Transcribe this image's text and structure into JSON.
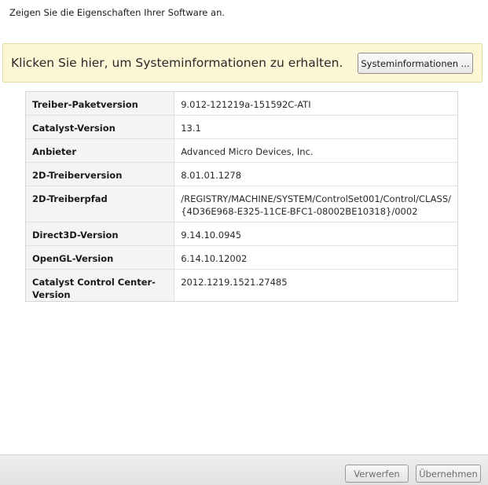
{
  "header": {
    "subtitle": "Zeigen Sie die Eigenschaften Ihrer Software an."
  },
  "banner": {
    "text": "Klicken Sie hier, um Systeminformationen zu erhalten.",
    "button_label": "Systeminformationen ..."
  },
  "properties": [
    {
      "key": "Treiber-Paketversion",
      "value": "9.012-121219a-151592C-ATI"
    },
    {
      "key": "Catalyst-Version",
      "value": "13.1"
    },
    {
      "key": "Anbieter",
      "value": "Advanced Micro Devices, Inc."
    },
    {
      "key": "2D-Treiberversion",
      "value": "8.01.01.1278"
    },
    {
      "key": "2D-Treiberpfad",
      "value": "/REGISTRY/MACHINE/SYSTEM/ControlSet001/Control/CLASS/",
      "value2": "{4D36E968-E325-11CE-BFC1-08002BE10318}/0002"
    },
    {
      "key": "Direct3D-Version",
      "value": "9.14.10.0945"
    },
    {
      "key": "OpenGL-Version",
      "value": "6.14.10.12002"
    },
    {
      "key": "Catalyst Control Center-Version",
      "value": "2012.1219.1521.27485"
    }
  ],
  "footer": {
    "discard_label": "Verwerfen",
    "apply_label": "Übernehmen"
  },
  "colors": {
    "banner_bg": "#fdf7d6",
    "banner_border": "#e8dca6",
    "table_key_bg": "#f4f4f4",
    "footer_bg": "#e8e8e8"
  }
}
